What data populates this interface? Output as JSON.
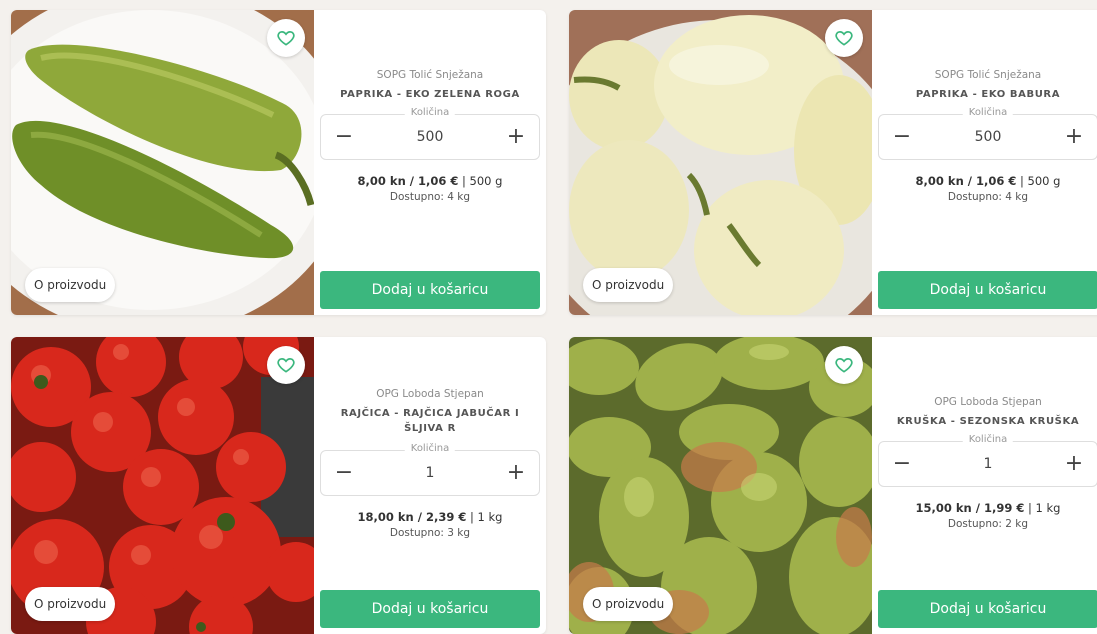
{
  "colors": {
    "accent": "#3bb77e",
    "heart": "#3bb77e",
    "background": "#f4f1ed"
  },
  "products": [
    {
      "producer": "SOPG Tolić Snježana",
      "name": "PAPRIKA - EKO ZELENA ROGA",
      "qty_label": "Količina",
      "qty_value": "500",
      "price_bold": "8,00 kn / 1,06 €",
      "price_unit": " | 500 g",
      "availability": "Dostupno: 4 kg",
      "add_label": "Dodaj u košaricu",
      "about_label": "O proizvodu",
      "favorite_icon": "heart-outline-icon"
    },
    {
      "producer": "SOPG Tolić Snježana",
      "name": "PAPRIKA - EKO BABURA",
      "qty_label": "Količina",
      "qty_value": "500",
      "price_bold": "8,00 kn / 1,06 €",
      "price_unit": " | 500 g",
      "availability": "Dostupno: 4 kg",
      "add_label": "Dodaj u košaricu",
      "about_label": "O proizvodu",
      "favorite_icon": "heart-outline-icon"
    },
    {
      "producer": "OPG Loboda Stjepan",
      "name": "RAJČICA - RAJČICA JABUČAR I ŠLJIVA R",
      "qty_label": "Količina",
      "qty_value": "1",
      "price_bold": "18,00 kn / 2,39 €",
      "price_unit": " | 1 kg",
      "availability": "Dostupno: 3 kg",
      "add_label": "Dodaj u košaricu",
      "about_label": "O proizvodu",
      "favorite_icon": "heart-outline-icon"
    },
    {
      "producer": "OPG Loboda Stjepan",
      "name": "KRUŠKA - SEZONSKA KRUŠKA",
      "qty_label": "Količina",
      "qty_value": "1",
      "price_bold": "15,00 kn / 1,99 €",
      "price_unit": " | 1 kg",
      "availability": "Dostupno: 2 kg",
      "add_label": "Dodaj u košaricu",
      "about_label": "O proizvodu",
      "favorite_icon": "heart-outline-icon"
    }
  ],
  "qty_controls": {
    "minus": "−",
    "plus": "+"
  }
}
